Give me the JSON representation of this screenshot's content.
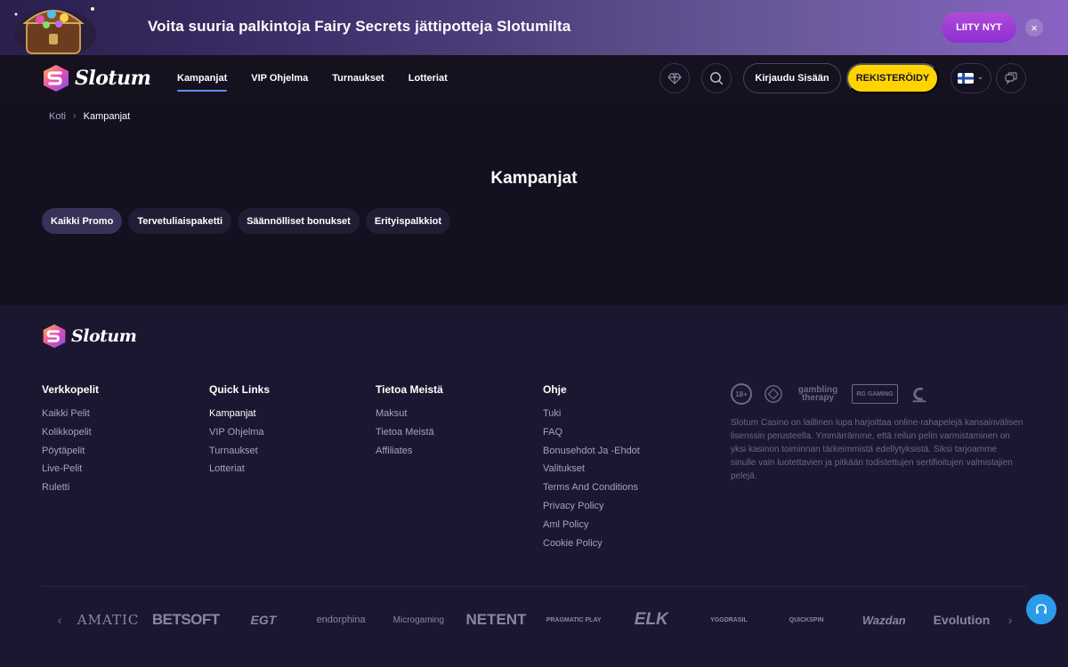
{
  "promo": {
    "text": "Voita suuria palkintoja Fairy Secrets jättipotteja Slotumilta",
    "join_label": "LIITY NYT",
    "close_symbol": "×"
  },
  "header": {
    "logo_text": "Slotum",
    "nav": [
      "Kampanjat",
      "VIP Ohjelma",
      "Turnaukset",
      "Lotteriat"
    ],
    "login_label": "Kirjaudu Sisään",
    "register_label": "REKISTERÖIDY",
    "lang_chevron": "⌄"
  },
  "breadcrumb": {
    "home": "Koti",
    "separator": "›",
    "current": "Kampanjat"
  },
  "main": {
    "title": "Kampanjat",
    "filters": [
      "Kaikki Promo",
      "Tervetuliaispaketti",
      "Säännölliset bonukset",
      "Erityispalkkiot"
    ]
  },
  "footer": {
    "logo_text": "Slotum",
    "columns": [
      {
        "title": "Verkkopelit",
        "links": [
          "Kaikki Pelit",
          "Kolikkopelit",
          "Pöytäpelit",
          "Live-Pelit",
          "Ruletti"
        ]
      },
      {
        "title": "Quick Links",
        "links": [
          "Kampanjat",
          "VIP Ohjelma",
          "Turnaukset",
          "Lotteriat"
        ]
      },
      {
        "title": "Tietoa Meistä",
        "links": [
          "Maksut",
          "Tietoa Meistä",
          "Affiliates"
        ]
      },
      {
        "title": "Ohje",
        "links": [
          "Tuki",
          "FAQ",
          "Bonusehdot Ja -Ehdot",
          "Valitukset",
          "Terms And Conditions",
          "Privacy Policy",
          "Aml Policy",
          "Cookie Policy"
        ]
      }
    ],
    "badges": [
      "18+",
      "gambling therapy",
      "RG GAMING"
    ],
    "license_text": "Slotum Casino on laillinen lupa harjoittaa online-rahapelejä kansainvälisen lisenssin perusteella. Ymmärrämme, että reilun pelin varmistaminen on yksi kasinon toiminnan tärkeimmistä edellytyksistä. Siksi tarjoamme sinulle vain luotettavien ja pitkään todistettujen sertifioitujen valmistajien pelejä.",
    "providers": [
      "AMATIC",
      "BETSOFT",
      "EGT",
      "endorphina",
      "Microgaming",
      "NETENT",
      "PRAGMATIC PLAY",
      "ELK",
      "YGGDRASIL",
      "QUICKSPIN",
      "Wazdan",
      "Evolution"
    ],
    "prev_arrow": "‹",
    "next_arrow": "›"
  }
}
